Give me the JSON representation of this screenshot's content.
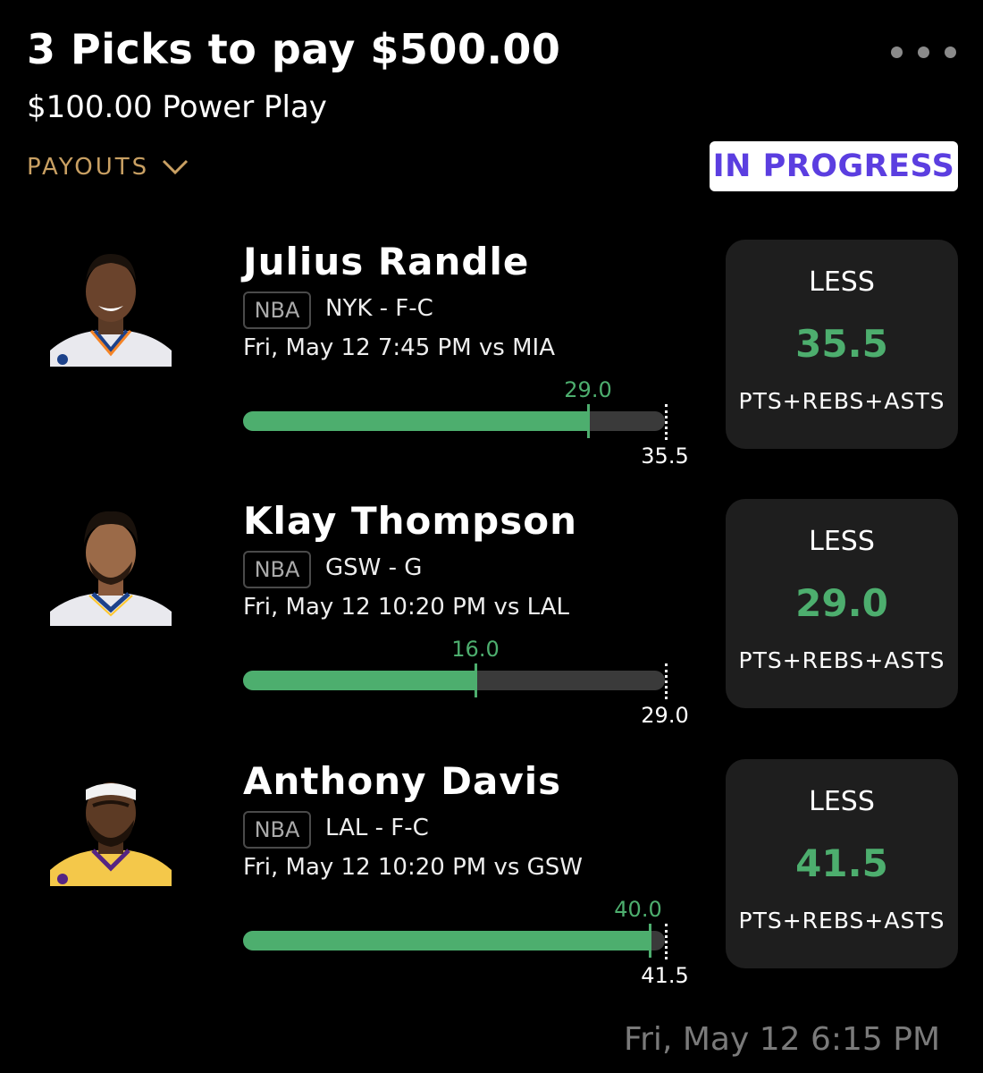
{
  "header": {
    "title": "3 Picks to pay $500.00",
    "subtitle": "$100.00 Power Play",
    "payouts_label": "PAYOUTS",
    "status": "IN PROGRESS"
  },
  "colors": {
    "background": "#000000",
    "accent_green": "#4dae6e",
    "payouts_gold": "#c9a063",
    "status_purple": "#5b3ee0",
    "card_bg": "#1e1e1e"
  },
  "picks": [
    {
      "player": "Julius Randle",
      "league": "NBA",
      "team_pos": "NYK - F-C",
      "game": "Fri, May 12 7:45 PM  vs MIA",
      "current": "29.0",
      "target": "35.5",
      "progress": 0.8169,
      "direction": "LESS",
      "line": "35.5",
      "stat": "PTS+REBS+ASTS"
    },
    {
      "player": "Klay Thompson",
      "league": "NBA",
      "team_pos": "GSW - G",
      "game": "Fri, May 12 10:20 PM  vs LAL",
      "current": "16.0",
      "target": "29.0",
      "progress": 0.5517,
      "direction": "LESS",
      "line": "29.0",
      "stat": "PTS+REBS+ASTS"
    },
    {
      "player": "Anthony Davis",
      "league": "NBA",
      "team_pos": "LAL - F-C",
      "game": "Fri, May 12 10:20 PM  vs GSW",
      "current": "40.0",
      "target": "41.5",
      "progress": 0.9639,
      "direction": "LESS",
      "line": "41.5",
      "stat": "PTS+REBS+ASTS"
    }
  ],
  "footer": {
    "timestamp": "Fri, May 12 6:15 PM"
  }
}
